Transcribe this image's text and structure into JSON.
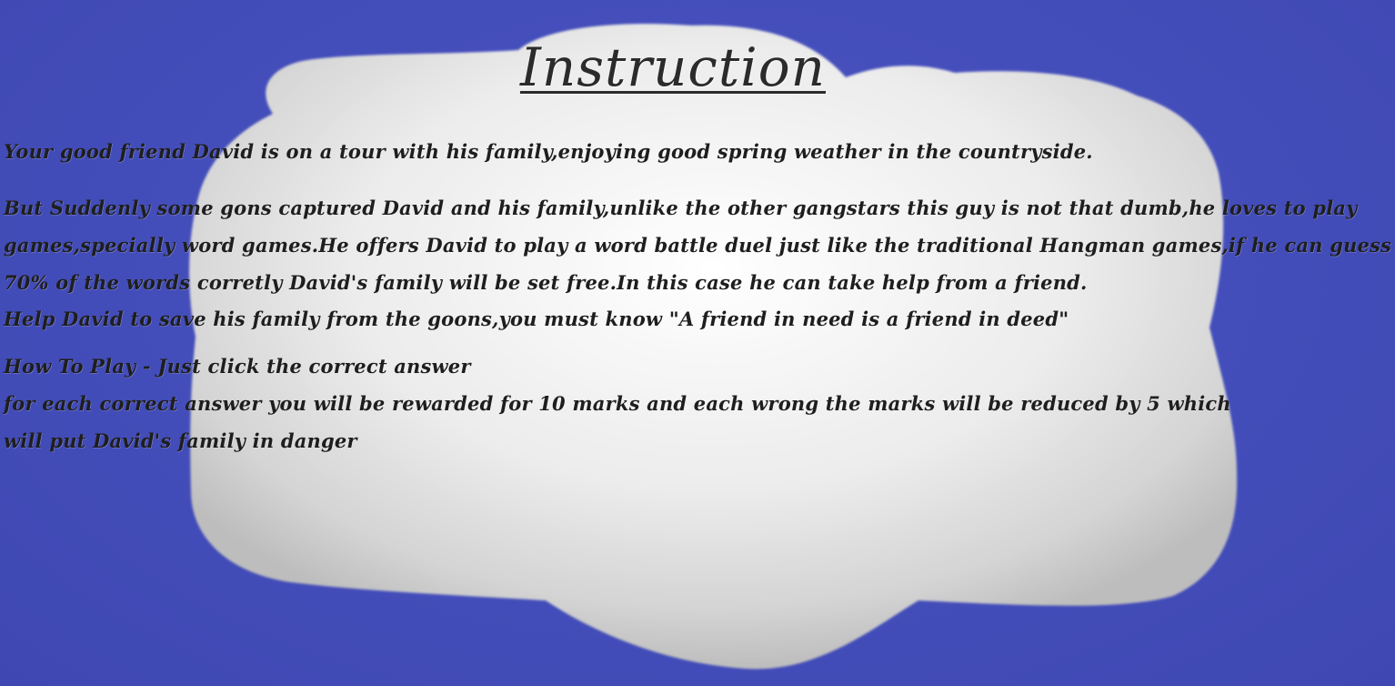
{
  "screen": {
    "title": "Instruction",
    "paragraphs": {
      "intro": "Your good friend David is on a tour with his family,enjoying good  spring weather in the countryside.",
      "story": [
        "But Suddenly some gons captured David and his family,unlike the other gangstars this guy is not that dumb,he loves to play",
        "games,specially word games.He offers David to play a word battle duel just like the traditional Hangman games,if he can guess",
        "70% of the words corretly David's family will be set free.In this case he can take help from a friend."
      ],
      "plea": "Help David to save his family from the goons,you must know \"A friend in need is a friend in deed\"",
      "how_to": [
        "How To Play - Just click the correct answer",
        "for each correct answer you will be rewarded for  10 marks and each wrong the marks will be reduced by 5 which",
        "will put David's family in danger"
      ]
    }
  },
  "colors": {
    "background": "#434db9",
    "cloud": "#f2f2f2",
    "text": "#1e1e1e"
  }
}
